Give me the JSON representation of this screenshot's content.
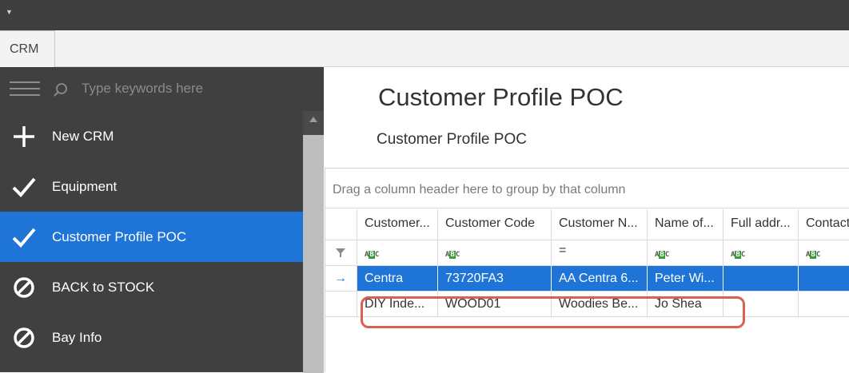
{
  "app": {
    "ribbon_tab": "CRM"
  },
  "sidebar": {
    "search_placeholder": "Type keywords here",
    "items": [
      {
        "label": "New CRM",
        "icon": "plus-icon",
        "active": false
      },
      {
        "label": "Equipment",
        "icon": "check-icon",
        "active": false
      },
      {
        "label": "Customer Profile POC",
        "icon": "check-icon",
        "active": true
      },
      {
        "label": "BACK to STOCK",
        "icon": "prohibited-icon",
        "active": false
      },
      {
        "label": "Bay Info",
        "icon": "prohibited-icon",
        "active": false
      }
    ]
  },
  "main": {
    "title": "Customer Profile POC",
    "subtitle": "Customer Profile POC",
    "group_panel": "Drag a column header here to group by that column",
    "columns": [
      "Customer...",
      "Customer Code",
      "Customer N...",
      "Name of...",
      "Full addr...",
      "Contact"
    ],
    "filter_row": [
      "ABC",
      "ABC",
      "=",
      "ABC",
      "ABC",
      "ABC"
    ],
    "rows": [
      {
        "cells": [
          "Centra",
          "73720FA3",
          "AA Centra 6...",
          "Peter Wi...",
          "",
          ""
        ],
        "selected": true
      },
      {
        "cells": [
          "DIY Inde...",
          "WOOD01",
          "Woodies Be...",
          "Jo Shea",
          "",
          ""
        ],
        "selected": false
      }
    ]
  },
  "colors": {
    "accent": "#1e74d7",
    "sidebar": "#404040",
    "highlight": "#d9624f"
  }
}
